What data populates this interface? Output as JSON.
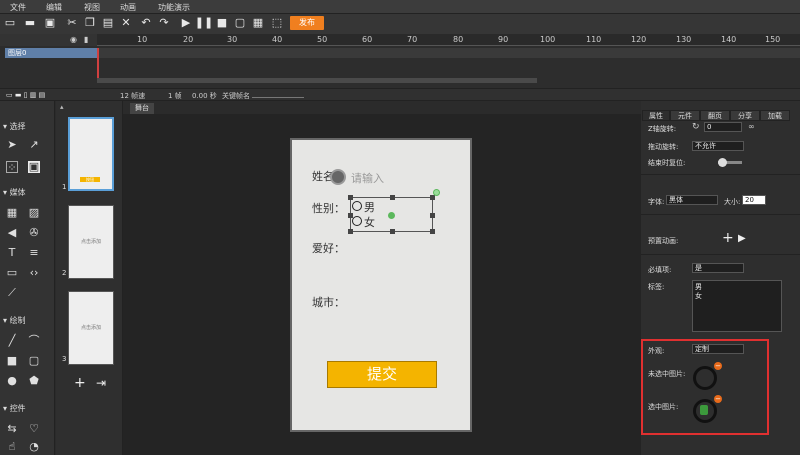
{
  "menu": [
    "文件",
    "编辑",
    "视图",
    "动画",
    "功能演示"
  ],
  "toolbar": {
    "publish_label": "发布"
  },
  "timeline": {
    "ruler": [
      "10",
      "20",
      "30",
      "40",
      "50",
      "60",
      "70",
      "80",
      "90",
      "100",
      "110",
      "120",
      "130",
      "140",
      "150"
    ],
    "layer_name": "图层0"
  },
  "statusbar": {
    "fps": "12 帧速",
    "frame": "1 帧",
    "time": "0.00 秒",
    "keyframe_label": "关键帧名"
  },
  "tools": {
    "sections": [
      "选择",
      "媒体",
      "绘制",
      "控件"
    ]
  },
  "pages": {
    "thumbs": [
      {
        "num": "1",
        "label": "按钮"
      },
      {
        "num": "2",
        "label": "点击添加"
      },
      {
        "num": "3",
        "label": "点击添加"
      }
    ]
  },
  "stage": {
    "tab": "舞台"
  },
  "form": {
    "name_label": "姓名",
    "name_placeholder": "请输入",
    "gender_label": "性别：",
    "options": [
      "男",
      "女"
    ],
    "hobby_label": "爱好：",
    "city_label": "城市：",
    "submit": "提交"
  },
  "props": {
    "tabs": [
      "属性",
      "元件",
      "翻页",
      "分享",
      "加载"
    ],
    "z_rotation_label": "Z轴旋转:",
    "z_rotation_value": "0",
    "drag_rotate_label": "拖动旋转:",
    "drag_rotate_value": "不允许",
    "reset_label": "结束时复位:",
    "font_label": "字体:",
    "font_value": "黑体",
    "size_label": "大小:",
    "size_value": "20",
    "preset_anim_label": "预置动画:",
    "required_label": "必填项:",
    "required_value": "是",
    "tags_label": "标签:",
    "tags_value": [
      "男",
      "女"
    ],
    "appearance_label": "外观:",
    "appearance_value": "定制",
    "unselected_label": "未选中图片:",
    "selected_label": "选中图片:"
  }
}
